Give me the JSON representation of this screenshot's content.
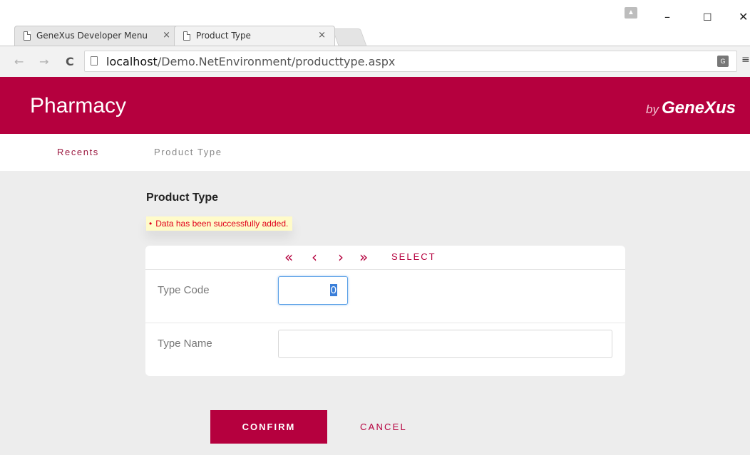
{
  "browser": {
    "tabs": [
      {
        "title": "GeneXus Developer Menu",
        "close": "×"
      },
      {
        "title": "Product Type",
        "close": "×"
      }
    ],
    "window_controls": {
      "minimize": "–",
      "maximize": "☐",
      "close": "✕"
    },
    "nav": {
      "back": "←",
      "forward": "→",
      "reload": "C"
    },
    "url_host": "localhost",
    "url_path": "/Demo.NetEnvironment/producttype.aspx",
    "menu_glyph": "≡"
  },
  "app": {
    "title": "Pharmacy",
    "brand_by": "by",
    "brand_name": "GeneXus",
    "accent_color": "#b5003e"
  },
  "nav_tabs": [
    {
      "label": "Recents"
    },
    {
      "label": "Product Type"
    }
  ],
  "panel": {
    "title": "Product Type",
    "message": "Data has been successfully added.",
    "pager": {
      "first": "«",
      "prev": "‹",
      "next": "›",
      "last": "»",
      "select": "SELECT"
    },
    "fields": {
      "code_label": "Type Code",
      "code_value": "0",
      "name_label": "Type Name",
      "name_value": ""
    }
  },
  "actions": {
    "confirm": "CONFIRM",
    "cancel": "CANCEL"
  }
}
